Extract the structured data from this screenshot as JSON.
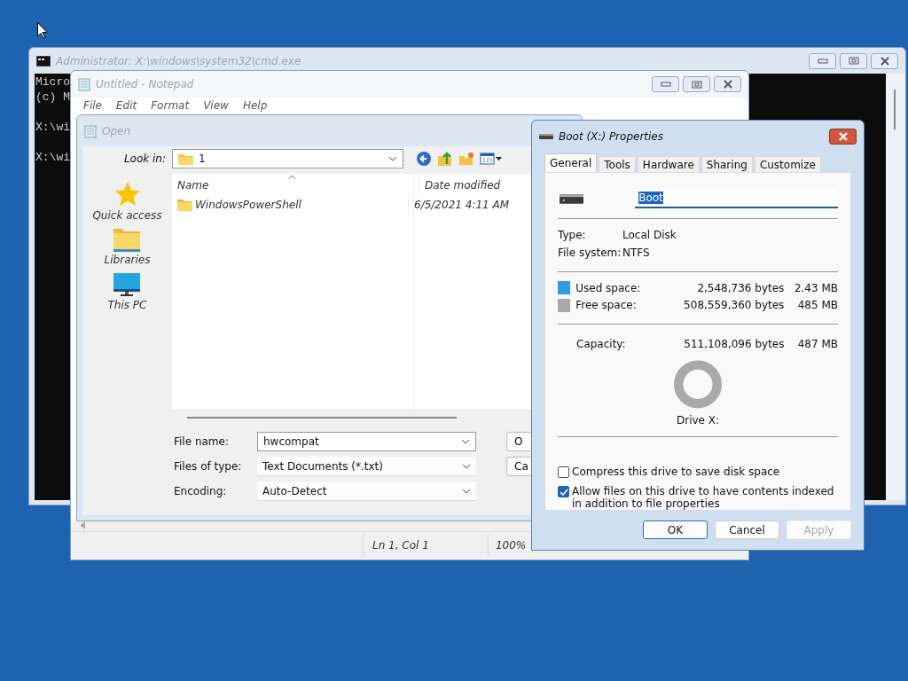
{
  "cmd_window": {
    "title": "Administrator: X:\\windows\\system32\\cmd.exe",
    "paragraphs": [
      [
        "Micro",
        "(c) M"
      ],
      [
        "X:\\wi"
      ],
      [
        "X:\\wi"
      ]
    ]
  },
  "notepad": {
    "title": "Untitled - Notepad",
    "menu": [
      "File",
      "Edit",
      "Format",
      "View",
      "Help"
    ],
    "status": [
      "Ln 1, Col 1",
      "100%"
    ]
  },
  "open_dialog": {
    "title": "Open",
    "look_in": {
      "label": "Look in:",
      "value": "1"
    },
    "places": [
      {
        "label": "Quick access",
        "kind": "star"
      },
      {
        "label": "Libraries",
        "kind": "folder"
      },
      {
        "label": "This PC",
        "kind": "pc"
      }
    ],
    "columns": [
      "Name",
      "Date modified"
    ],
    "rows": [
      {
        "name": "WindowsPowerShell",
        "date": "6/5/2021 4:11 AM"
      }
    ],
    "fields": [
      {
        "label": "File name:",
        "value": "hwcompat",
        "kind": "text"
      },
      {
        "label": "Files of type:",
        "value": "Text Documents (*.txt)",
        "kind": "select"
      },
      {
        "label": "Encoding:",
        "value": "Auto-Detect",
        "kind": "select"
      }
    ],
    "buttons": [
      "O",
      "Ca"
    ]
  },
  "properties": {
    "title": "Boot (X:) Properties",
    "tabs": [
      {
        "label": "General",
        "selected": true
      },
      {
        "label": "Tools",
        "selected": false
      },
      {
        "label": "Hardware",
        "selected": false
      },
      {
        "label": "Sharing",
        "selected": false
      },
      {
        "label": "Customize",
        "selected": false
      }
    ],
    "name_field": {
      "value": "Boot",
      "selected": true
    },
    "info": [
      {
        "label": "Type:",
        "value": "Local Disk"
      },
      {
        "label": "File system:",
        "value": "NTFS"
      }
    ],
    "space": [
      {
        "label": "Used space:",
        "bytes": "2,548,736 bytes",
        "size": "2.43 MB",
        "color": "#2e9fdf"
      },
      {
        "label": "Free space:",
        "bytes": "508,559,360 bytes",
        "size": "485 MB",
        "color": "#a9a9a9"
      }
    ],
    "capacity": {
      "label": "Capacity:",
      "bytes": "511,108,096 bytes",
      "size": "487 MB"
    },
    "drive_label": "Drive X:",
    "options": [
      {
        "label": "Compress this drive to save disk space",
        "checked": false
      },
      {
        "label": "Allow files on this drive to have contents indexed in addition to file properties",
        "checked": true
      }
    ],
    "buttons": [
      {
        "label": "OK",
        "kind": "default",
        "disabled": false
      },
      {
        "label": "Cancel",
        "kind": "normal",
        "disabled": false
      },
      {
        "label": "Apply",
        "kind": "normal",
        "disabled": true
      }
    ]
  }
}
